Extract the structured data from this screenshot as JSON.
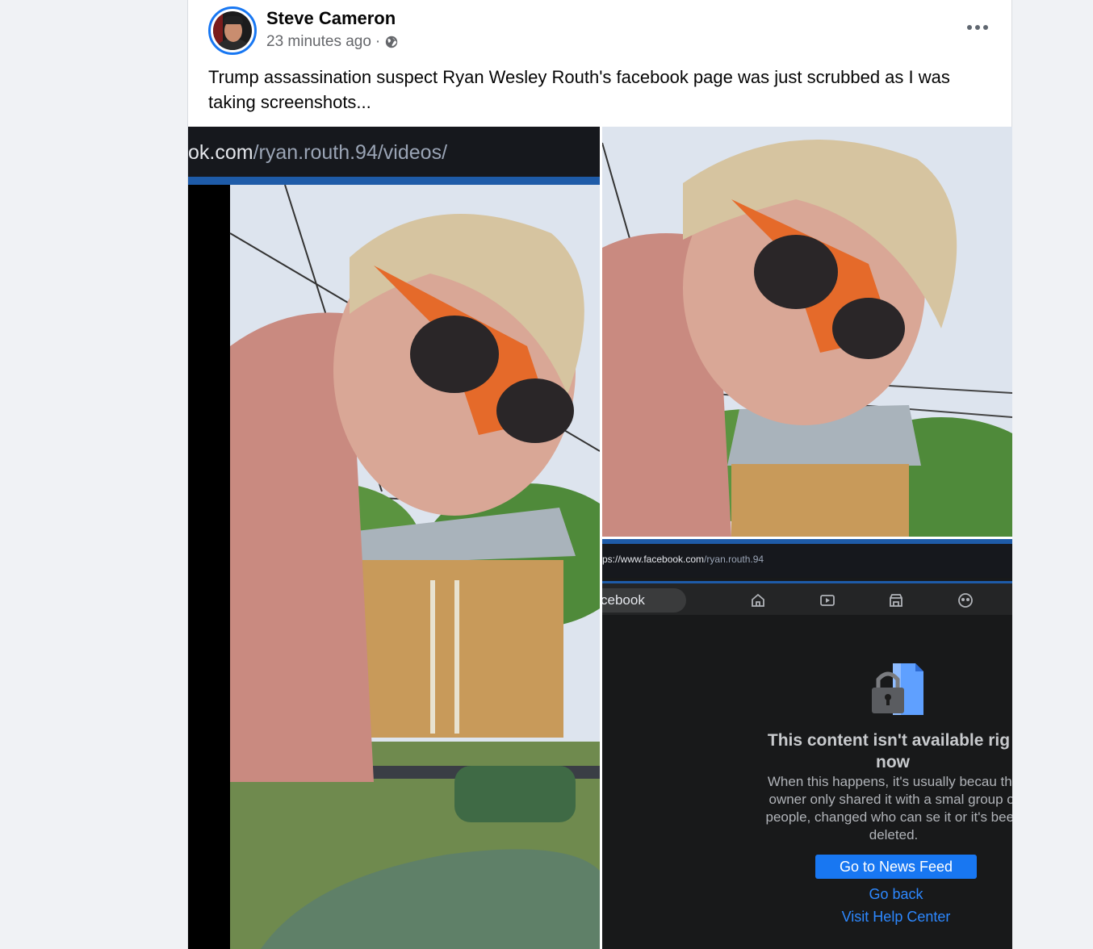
{
  "post": {
    "author": "Steve Cameron",
    "timestamp": "23 minutes ago",
    "separator": "·",
    "audience_icon": "globe-icon",
    "more_icon": "more-horizontal-icon",
    "caption": "Trump assassination suspect Ryan Wesley Routh's facebook page was just scrubbed as I was taking screenshots..."
  },
  "photos": {
    "photo1": {
      "url_prefix": "ok.com",
      "url_path": "/ryan.routh.94/videos/"
    },
    "photo3": {
      "url_prefix": "ps://www.facebook.com",
      "url_path": "/ryan.routh.94",
      "search_text": "cebook",
      "nav_icons": [
        "home-icon",
        "video-icon",
        "marketplace-icon",
        "groups-icon"
      ],
      "error_title_line1": "This content isn't available rig",
      "error_title_line2": "now",
      "error_body": "When this happens, it's usually becau the owner only shared it with a smal group of people, changed who can se it or it's been deleted.",
      "primary_button": "Go to News Feed",
      "link_back": "Go back",
      "link_help": "Visit Help Center"
    }
  },
  "colors": {
    "accent": "#1877f2",
    "link": "#2d88ff",
    "dark_bg": "#18191a"
  }
}
